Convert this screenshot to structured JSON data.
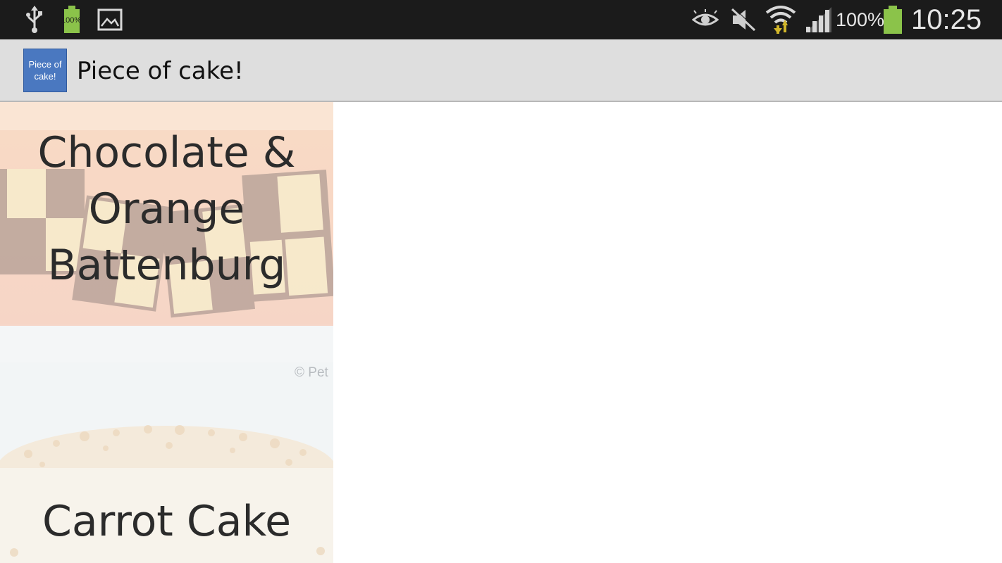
{
  "status_bar": {
    "battery_small_label": "100%",
    "battery_percent": "100%",
    "time": "10:25",
    "icons": [
      "usb-icon",
      "battery-icon",
      "gallery-icon",
      "eye-icon",
      "mute-icon",
      "wifi-icon",
      "signal-icon",
      "battery-icon"
    ]
  },
  "action_bar": {
    "app_icon_text": "Piece of cake!",
    "title": "Piece of cake!"
  },
  "recipes": [
    {
      "title": "Chocolate & Orange Battenburg"
    },
    {
      "title": "Carrot Cake"
    }
  ],
  "watermark": "© Pet",
  "colors": {
    "status_bar": "#1b1b1b",
    "action_bar": "#dedede",
    "app_icon": "#4a78c0",
    "battery_green": "#8bc34a"
  }
}
